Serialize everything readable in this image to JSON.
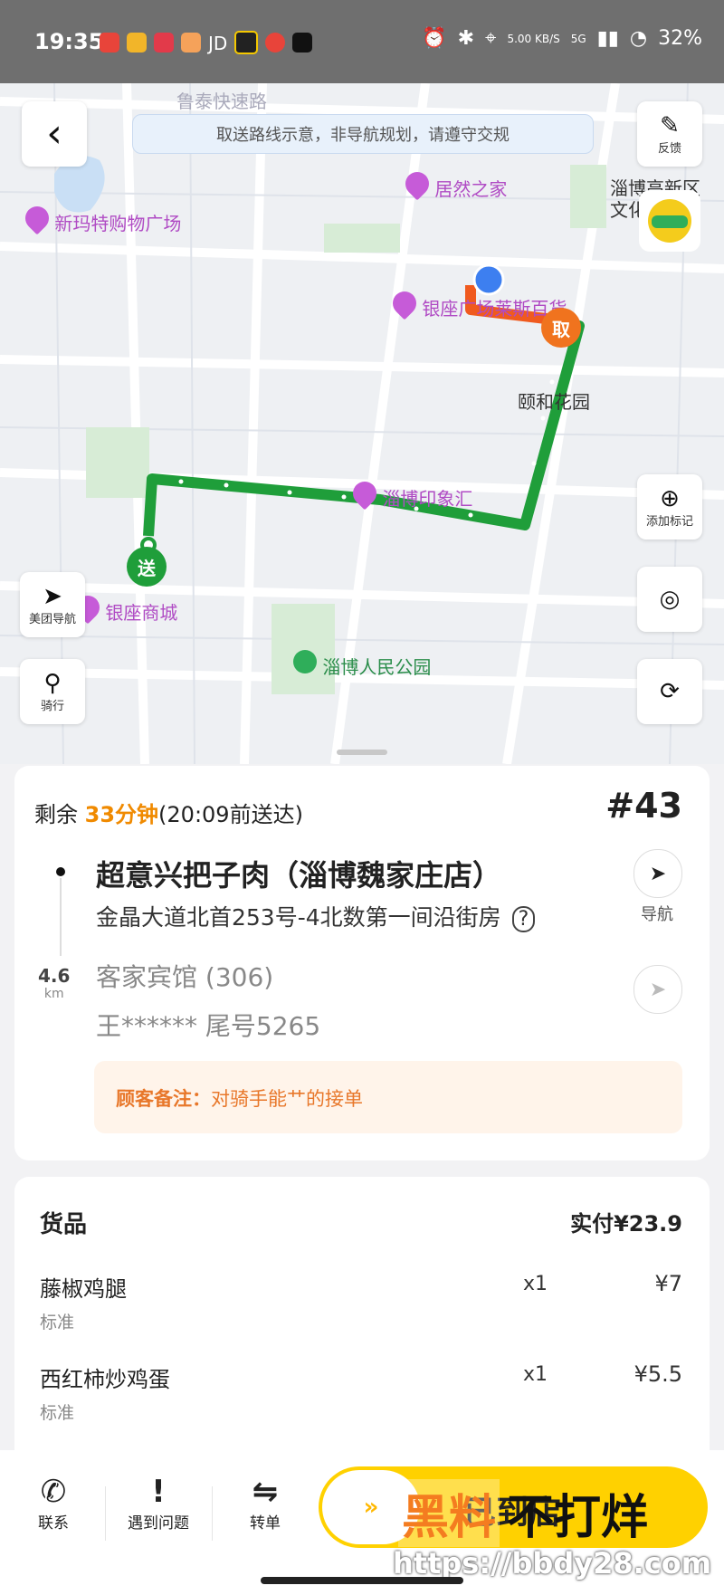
{
  "status_bar": {
    "time": "19:35",
    "app_label": "JD",
    "net_speed": "5.00 KB/S",
    "net_type": "5G",
    "battery": "32%"
  },
  "map": {
    "notice": "取送路线示意，非导航规划，请遵守交规",
    "road_label": "鲁泰快速路",
    "pois": [
      {
        "name": "居然之家"
      },
      {
        "name": "新玛特购物广场"
      },
      {
        "name": "银座广场莱斯百货"
      },
      {
        "name": "颐和花园"
      },
      {
        "name": "淄博印象汇"
      },
      {
        "name": "银座商城"
      },
      {
        "name": "淄博人民公园"
      },
      {
        "name": "淄博高新区文化"
      }
    ],
    "pickup_marker": "取",
    "delivery_marker": "送",
    "buttons": {
      "back": "‹",
      "feedback": "反馈",
      "add_mark": "添加标记",
      "meituan_nav": "美团导航",
      "riding": "骑行"
    },
    "colors": {
      "route_delivery": "#1f9e3a",
      "route_pickup": "#f05a1e",
      "courier": "#3d7ff0"
    }
  },
  "order": {
    "remain_prefix": "剩余",
    "remain_time": "33分钟",
    "remain_suffix": "(20:09前送达)",
    "order_no": "#43",
    "shop_name": "超意兴把子肉（淄博魏家庄店）",
    "shop_address": "金晶大道北首253号-4北数第一间沿街房",
    "nav_label": "导航",
    "distance": "4.6",
    "distance_unit": "km",
    "destination": "客家宾馆 (306)",
    "customer": "王****** 尾号5265",
    "note_label": "顾客备注：",
    "note_text": "对骑手能艹的接单"
  },
  "goods": {
    "title": "货品",
    "paid": "实付¥23.9",
    "items": [
      {
        "name": "藤椒鸡腿",
        "spec": "标准",
        "qty": "x1",
        "price": "¥7"
      },
      {
        "name": "西红柿炒鸡蛋",
        "spec": "标准",
        "qty": "x1",
        "price": "¥5.5"
      }
    ]
  },
  "bottom_bar": {
    "contact": "联系",
    "problem": "遇到问题",
    "transfer": "转单",
    "slide_label": "已到店"
  },
  "watermark": {
    "brand_a": "黑料",
    "brand_b": "不打烊",
    "url": "https://bbdy28.com"
  }
}
